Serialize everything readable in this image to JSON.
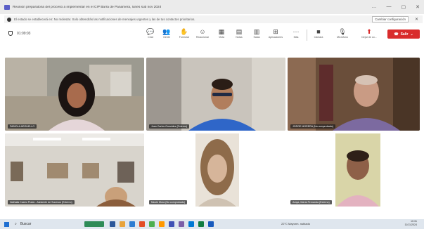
{
  "window": {
    "title": "Reunión preparatoria del proceso a implementar en el CIP Barra de Panamera, lunes sub nov 2024",
    "controls": [
      "…",
      "—",
      "▢",
      "✕"
    ]
  },
  "banner": {
    "text": "El estado se establecerá en: No molestar. Solo obtendrás las notificaciones de mensajes urgentes y las de tus contactos prioritarios.",
    "settings_label": "Cambiar configuración"
  },
  "meeting": {
    "timer": "01:09:03",
    "leave_label": "Salir"
  },
  "toolbar": [
    {
      "icon": "chat-icon",
      "glyph": "💬",
      "label": "Chat"
    },
    {
      "icon": "people-icon",
      "glyph": "👥",
      "label": "Gente"
    },
    {
      "icon": "raise-hand-icon",
      "glyph": "✋",
      "label": "Formular"
    },
    {
      "icon": "reactions-icon",
      "glyph": "☺",
      "label": "Reaccionar"
    },
    {
      "icon": "view-icon",
      "glyph": "▦",
      "label": "Vista"
    },
    {
      "icon": "notes-icon",
      "glyph": "▤",
      "label": "Notas"
    },
    {
      "icon": "rooms-icon",
      "glyph": "▥",
      "label": "Salas"
    },
    {
      "icon": "apps-icon",
      "glyph": "⊞",
      "label": "Aplicaciones"
    },
    {
      "icon": "more-icon",
      "glyph": "···",
      "label": "Más"
    },
    {
      "icon": "camera-icon",
      "glyph": "■",
      "label": "Cámara"
    },
    {
      "icon": "mic-icon",
      "glyph": "🎙",
      "label": "Micrófono"
    },
    {
      "icon": "share-icon",
      "glyph": "⬆",
      "label": "Dejar de co..."
    }
  ],
  "participants": [
    {
      "name": "FABIOLA ARGUELLO",
      "bg": "#8a8f86"
    },
    {
      "name": "Juan Carlos González (Externo)",
      "bg": "#c9c4bc"
    },
    {
      "name": "JORGE MORERA (No comprobado)",
      "bg": "#6a4e3a"
    },
    {
      "name": "Nathalia Castro Prado - Asistente de Sucesos (Externo)",
      "bg": "#b9b6ae"
    },
    {
      "name": "Nicole Mora (No comprobado)",
      "bg": "#ffffff"
    },
    {
      "name": "Araya, María Fernanda (Externo)",
      "bg": "#ffffff"
    }
  ],
  "taskbar": {
    "search_label": "Buscar",
    "weather": "22°C Mayorm. nublado",
    "time": "10:31",
    "date": "11/11/2024"
  }
}
